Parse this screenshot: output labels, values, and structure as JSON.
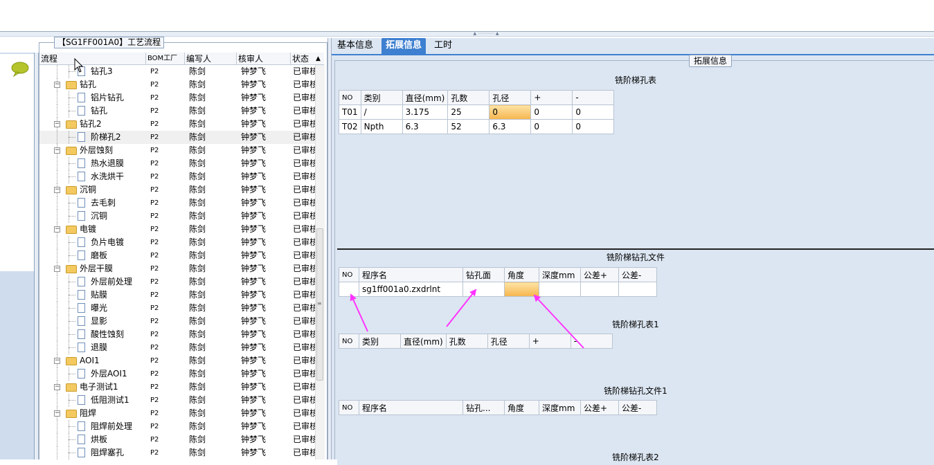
{
  "tree_panel": {
    "title": "【SG1FF001A0】工艺流程",
    "columns": [
      "流程",
      "BOM工厂",
      "编写人",
      "核审人",
      "状态"
    ],
    "rows": [
      {
        "level": 2,
        "type": "file",
        "name": "钻孔3",
        "bom": "P2",
        "writer": "陈剑",
        "reviewer": "钟梦飞",
        "status": "已审核"
      },
      {
        "level": 1,
        "type": "folder",
        "name": "钻孔",
        "bom": "P2",
        "writer": "陈剑",
        "reviewer": "钟梦飞",
        "status": "已审核"
      },
      {
        "level": 2,
        "type": "file",
        "name": "铝片钻孔",
        "bom": "P2",
        "writer": "陈剑",
        "reviewer": "钟梦飞",
        "status": "已审核"
      },
      {
        "level": 2,
        "type": "file",
        "name": "钻孔",
        "bom": "P2",
        "writer": "陈剑",
        "reviewer": "钟梦飞",
        "status": "已审核"
      },
      {
        "level": 1,
        "type": "folder",
        "name": "钻孔2",
        "bom": "P2",
        "writer": "陈剑",
        "reviewer": "钟梦飞",
        "status": "已审核"
      },
      {
        "level": 2,
        "type": "file",
        "name": "阶梯孔2",
        "bom": "P2",
        "writer": "陈剑",
        "reviewer": "钟梦飞",
        "status": "已审核",
        "selected": true
      },
      {
        "level": 1,
        "type": "folder",
        "name": "外层蚀刻",
        "bom": "P2",
        "writer": "陈剑",
        "reviewer": "钟梦飞",
        "status": "已审核"
      },
      {
        "level": 2,
        "type": "file",
        "name": "热水退膜",
        "bom": "P2",
        "writer": "陈剑",
        "reviewer": "钟梦飞",
        "status": "已审核"
      },
      {
        "level": 2,
        "type": "file",
        "name": "水洗烘干",
        "bom": "P2",
        "writer": "陈剑",
        "reviewer": "钟梦飞",
        "status": "已审核"
      },
      {
        "level": 1,
        "type": "folder",
        "name": "沉铜",
        "bom": "P2",
        "writer": "陈剑",
        "reviewer": "钟梦飞",
        "status": "已审核"
      },
      {
        "level": 2,
        "type": "file",
        "name": "去毛刺",
        "bom": "P2",
        "writer": "陈剑",
        "reviewer": "钟梦飞",
        "status": "已审核"
      },
      {
        "level": 2,
        "type": "file",
        "name": "沉铜",
        "bom": "P2",
        "writer": "陈剑",
        "reviewer": "钟梦飞",
        "status": "已审核"
      },
      {
        "level": 1,
        "type": "folder",
        "name": "电镀",
        "bom": "P2",
        "writer": "陈剑",
        "reviewer": "钟梦飞",
        "status": "已审核"
      },
      {
        "level": 2,
        "type": "file",
        "name": "负片电镀",
        "bom": "P2",
        "writer": "陈剑",
        "reviewer": "钟梦飞",
        "status": "已审核"
      },
      {
        "level": 2,
        "type": "file",
        "name": "磨板",
        "bom": "P2",
        "writer": "陈剑",
        "reviewer": "钟梦飞",
        "status": "已审核"
      },
      {
        "level": 1,
        "type": "folder",
        "name": "外层干膜",
        "bom": "P2",
        "writer": "陈剑",
        "reviewer": "钟梦飞",
        "status": "已审核"
      },
      {
        "level": 2,
        "type": "file",
        "name": "外层前处理",
        "bom": "P2",
        "writer": "陈剑",
        "reviewer": "钟梦飞",
        "status": "已审核"
      },
      {
        "level": 2,
        "type": "file",
        "name": "贴膜",
        "bom": "P2",
        "writer": "陈剑",
        "reviewer": "钟梦飞",
        "status": "已审核"
      },
      {
        "level": 2,
        "type": "file",
        "name": "曝光",
        "bom": "P2",
        "writer": "陈剑",
        "reviewer": "钟梦飞",
        "status": "已审核"
      },
      {
        "level": 2,
        "type": "file",
        "name": "显影",
        "bom": "P2",
        "writer": "陈剑",
        "reviewer": "钟梦飞",
        "status": "已审核"
      },
      {
        "level": 2,
        "type": "file",
        "name": "酸性蚀刻",
        "bom": "P2",
        "writer": "陈剑",
        "reviewer": "钟梦飞",
        "status": "已审核"
      },
      {
        "level": 2,
        "type": "file",
        "name": "退膜",
        "bom": "P2",
        "writer": "陈剑",
        "reviewer": "钟梦飞",
        "status": "已审核"
      },
      {
        "level": 1,
        "type": "folder",
        "name": "AOI1",
        "bom": "P2",
        "writer": "陈剑",
        "reviewer": "钟梦飞",
        "status": "已审核"
      },
      {
        "level": 2,
        "type": "file",
        "name": "外层AOI1",
        "bom": "P2",
        "writer": "陈剑",
        "reviewer": "钟梦飞",
        "status": "已审核"
      },
      {
        "level": 1,
        "type": "folder",
        "name": "电子测试1",
        "bom": "P2",
        "writer": "陈剑",
        "reviewer": "钟梦飞",
        "status": "已审核"
      },
      {
        "level": 2,
        "type": "file",
        "name": "低阻测试1",
        "bom": "P2",
        "writer": "陈剑",
        "reviewer": "钟梦飞",
        "status": "已审核"
      },
      {
        "level": 1,
        "type": "folder",
        "name": "阻焊",
        "bom": "P2",
        "writer": "陈剑",
        "reviewer": "钟梦飞",
        "status": "已审核"
      },
      {
        "level": 2,
        "type": "file",
        "name": "阻焊前处理",
        "bom": "P2",
        "writer": "陈剑",
        "reviewer": "钟梦飞",
        "status": "已审核"
      },
      {
        "level": 2,
        "type": "file",
        "name": "烘板",
        "bom": "P2",
        "writer": "陈剑",
        "reviewer": "钟梦飞",
        "status": "已审核"
      },
      {
        "level": 2,
        "type": "file",
        "name": "阻焊塞孔",
        "bom": "P2",
        "writer": "陈剑",
        "reviewer": "钟梦飞",
        "status": "已审核"
      }
    ]
  },
  "tabs": [
    "基本信息",
    "拓展信息",
    "工时"
  ],
  "active_tab": "拓展信息",
  "ext_group_title": "拓展信息",
  "sections": {
    "hole_table": {
      "title": "铣阶梯孔表",
      "columns": [
        "NO",
        "类别",
        "直径(mm)",
        "孔数",
        "孔径",
        "+",
        "-"
      ],
      "rows": [
        [
          "T01",
          "/",
          "3.175",
          "25",
          "0",
          "0",
          "0"
        ],
        [
          "T02",
          "Npth",
          "6.3",
          "52",
          "6.3",
          "0",
          "0"
        ]
      ]
    },
    "drill_file": {
      "title": "铣阶梯钻孔文件",
      "columns": [
        "NO",
        "程序名",
        "钻孔面",
        "角度",
        "深度mm",
        "公差+",
        "公差-"
      ],
      "rows": [
        [
          "",
          "sg1ff001a0.zxdrlnt",
          "",
          "",
          "",
          "",
          ""
        ]
      ]
    },
    "hole_table1": {
      "title": "铣阶梯孔表1",
      "columns": [
        "NO",
        "类别",
        "直径(mm)",
        "孔数",
        "孔径",
        "+",
        "-"
      ]
    },
    "drill_file1": {
      "title": "铣阶梯钻孔文件1",
      "columns": [
        "NO",
        "程序名",
        "钻孔...",
        "角度",
        "深度mm",
        "公差+",
        "公差-"
      ]
    },
    "hole_table2": {
      "title": "铣阶梯孔表2"
    }
  },
  "colors": {
    "accent": "#3d7fd0",
    "annotation_arrow": "#ff33ff",
    "highlight_orange": "#f6b54d",
    "panel_bg": "#dce6f2"
  },
  "icons": {
    "chat": "chat-bubble-icon",
    "folder": "folder-icon",
    "file": "document-icon"
  }
}
